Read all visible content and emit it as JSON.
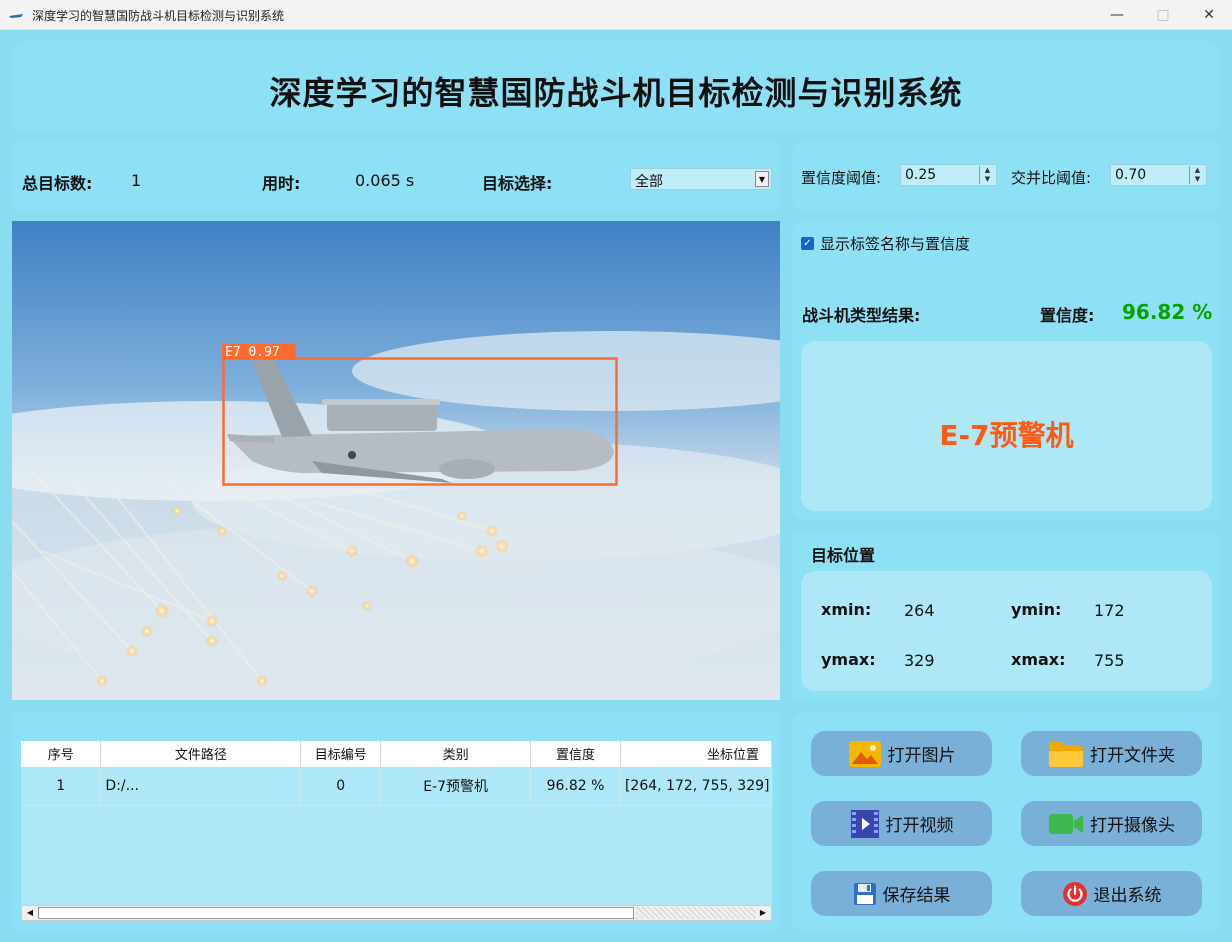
{
  "window": {
    "title": "深度学习的智慧国防战斗机目标检测与识别系统"
  },
  "header": {
    "title": "深度学习的智慧国防战斗机目标检测与识别系统"
  },
  "stats": {
    "total_label": "总目标数:",
    "total_value": "1",
    "time_label": "用时:",
    "time_value": "0.065 s",
    "target_select_label": "目标选择:",
    "target_select_value": "全部"
  },
  "thresholds": {
    "conf_label": "置信度阈值:",
    "conf_value": "0.25",
    "iou_label": "交并比阈值:",
    "iou_value": "0.70"
  },
  "result": {
    "show_label_text": "显示标签名称与置信度",
    "show_label_checked": true,
    "type_label": "战斗机类型结果:",
    "confidence_label": "置信度:",
    "confidence_value": "96.82 %",
    "class_name": "E-7预警机",
    "class_color": "#ff5a14",
    "confidence_color": "#0aa000"
  },
  "position": {
    "title": "目标位置",
    "xmin_label": "xmin:",
    "xmin_value": "264",
    "ymin_label": "ymin:",
    "ymin_value": "172",
    "ymax_label": "ymax:",
    "ymax_value": "329",
    "xmax_label": "xmax:",
    "xmax_value": "755"
  },
  "detection": {
    "box_label": "E7  0.97",
    "box_color": "#ff6a30"
  },
  "table": {
    "headers": [
      "序号",
      "文件路径",
      "目标编号",
      "类别",
      "置信度",
      "坐标位置"
    ],
    "rows": [
      [
        "1",
        "D:/...",
        "0",
        "E-7预警机",
        "96.82 %",
        "[264, 172, 755, 329]"
      ]
    ]
  },
  "buttons": {
    "open_image": "打开图片",
    "open_folder": "打开文件夹",
    "open_video": "打开视频",
    "open_camera": "打开摄像头",
    "save_result": "保存结果",
    "exit_system": "退出系统"
  }
}
